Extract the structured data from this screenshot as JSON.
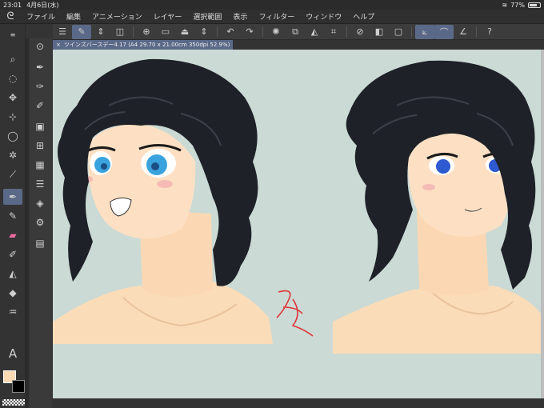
{
  "status": {
    "time": "23:01",
    "date": "4月6日(水)",
    "battery": "77%",
    "battery_level": 0.77
  },
  "menu": {
    "items": [
      "ファイル",
      "編集",
      "アニメーション",
      "レイヤー",
      "選択範囲",
      "表示",
      "フィルター",
      "ウィンドウ",
      "ヘルプ"
    ]
  },
  "document": {
    "tab_label": "ツインズバースデー4.17 (A4 29.70 x 21.00cm 350dpi 52.9%)"
  },
  "colors": {
    "canvas_bg": "#cbdad5",
    "accent": "#5a6988",
    "main_color": "#fbd9b4",
    "sub_color": "#000000"
  },
  "tools": {
    "col1": [
      "search-icon",
      "rotate-icon",
      "move-icon",
      "transform-icon",
      "lasso-icon",
      "magic-wand-icon",
      "eyedropper-icon",
      "pen-icon",
      "pencil-icon",
      "brush-icon",
      "airbrush-icon",
      "fill-icon",
      "eraser-icon",
      "blend-icon",
      "text-icon"
    ],
    "col2": [
      "cursor-icon",
      "pen-sub1-icon",
      "pen-sub2-icon",
      "pen-sub3-icon",
      "layer-icon",
      "grid-icon",
      "film-icon",
      "list-icon",
      "stack-icon",
      "frame-icon"
    ]
  }
}
